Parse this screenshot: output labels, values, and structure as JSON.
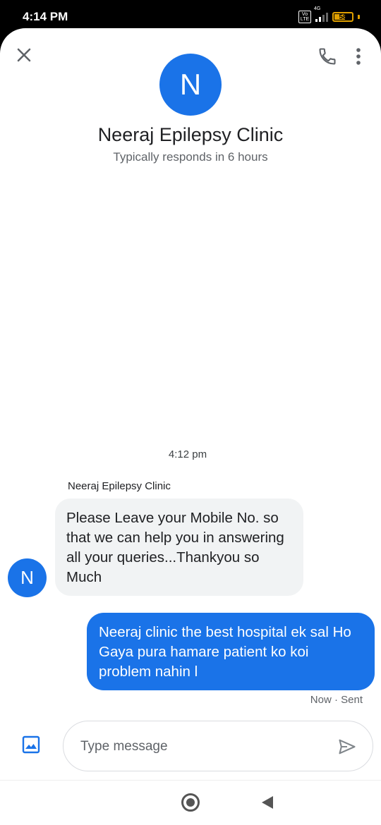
{
  "status_bar": {
    "time": "4:14 PM",
    "volte": "Vo LTE",
    "network": "4G",
    "battery_level": 58,
    "battery_label": "58"
  },
  "header": {
    "close_icon": "close-icon",
    "call_icon": "phone-icon",
    "more_icon": "more-vert-icon",
    "avatar_letter": "N",
    "contact_name": "Neeraj Epilepsy Clinic",
    "response_time": "Typically responds in 6 hours"
  },
  "conversation": {
    "timestamp": "4:12 pm",
    "incoming": {
      "sender": "Neeraj Epilepsy Clinic",
      "avatar_letter": "N",
      "text": "Please Leave your Mobile No. so that we can help you in answering all your queries...Thankyou so Much"
    },
    "outgoing": {
      "text": "Neeraj clinic the best hospital ek sal Ho Gaya pura hamare patient ko koi problem nahin l",
      "status": "Now · Sent"
    }
  },
  "composer": {
    "media_icon": "image-icon",
    "placeholder": "Type message",
    "value": "",
    "send_icon": "send-icon"
  },
  "nav_bar": {
    "home_icon": "home-circle-icon",
    "back_icon": "back-triangle-icon"
  },
  "colors": {
    "accent": "#1a73e8",
    "incoming_bubble": "#f1f3f4",
    "battery": "#e0a000"
  }
}
